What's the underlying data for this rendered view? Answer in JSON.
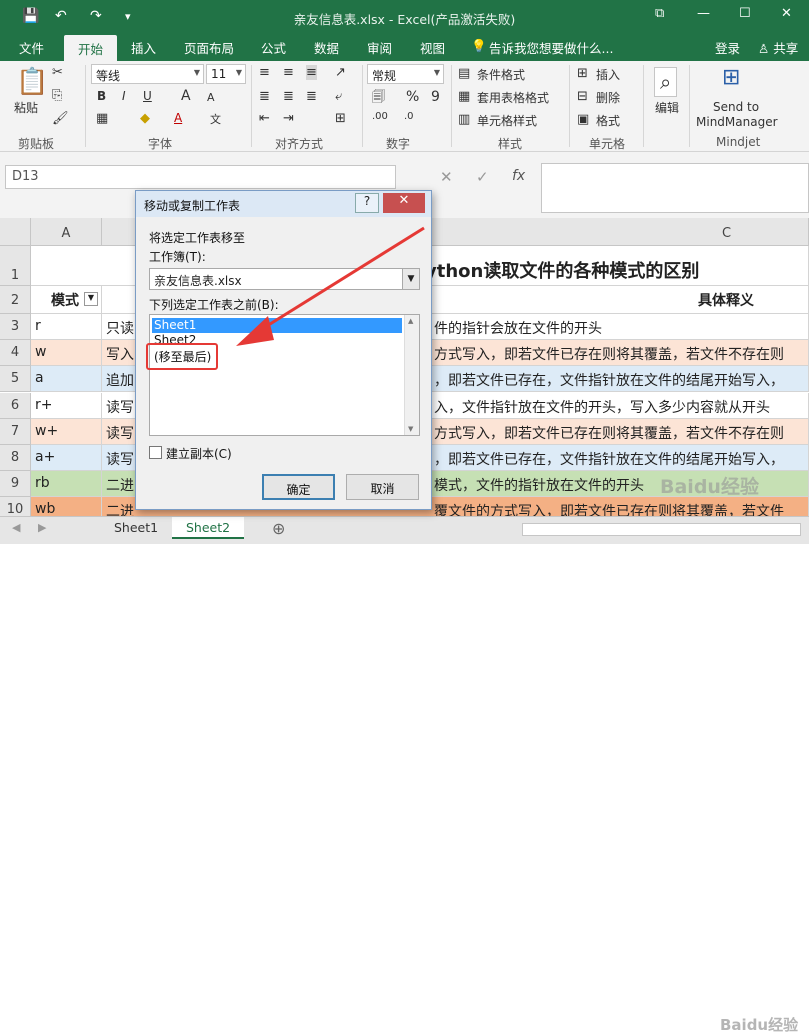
{
  "window": {
    "title": "亲友信息表.xlsx - Excel(产品激活失败)",
    "controls": {
      "restore": "⧉",
      "minimize": "—",
      "maximize": "☐",
      "close": "✕"
    }
  },
  "quick_access": {
    "save": "💾",
    "undo": "↶",
    "redo": "↷",
    "customize": "▾"
  },
  "ribbon_tabs": {
    "file": "文件",
    "home": "开始",
    "insert": "插入",
    "layout": "页面布局",
    "formulas": "公式",
    "data": "数据",
    "review": "审阅",
    "view": "视图",
    "tell_me": "告诉我您想要做什么...",
    "login": "登录",
    "share": "共享"
  },
  "ribbon": {
    "clipboard": {
      "paste": "粘贴",
      "label": "剪贴板"
    },
    "font": {
      "name": "等线",
      "size": "11",
      "bold": "B",
      "italic": "I",
      "underline": "U",
      "size_up": "A",
      "size_down": "A",
      "font_color": "A",
      "label": "字体"
    },
    "align": {
      "label": "对齐方式"
    },
    "number": {
      "format": "常规",
      "percent": "%",
      "comma": "9",
      "label": "数字"
    },
    "styles": {
      "conditional": "条件格式",
      "table": "套用表格格式",
      "cell_style": "单元格样式",
      "label": "样式"
    },
    "cells": {
      "insert": "插入",
      "delete": "删除",
      "format": "格式",
      "label": "单元格"
    },
    "editing": {
      "label": "编辑"
    },
    "mindjet": {
      "send_line1": "Send to",
      "send_line2": "MindManager",
      "label": "Mindjet"
    }
  },
  "formula_bar": {
    "name_box": "D13",
    "fx": "fx"
  },
  "grid": {
    "col_headers": {
      "a": "A",
      "c": "C"
    },
    "row_headers": [
      "1",
      "2",
      "3",
      "4",
      "5",
      "6",
      "7",
      "8",
      "9",
      "10"
    ],
    "title_cell": "ython读取文件的各种模式的区别",
    "header_a": "模式",
    "header_c": "具体释义",
    "rows": [
      {
        "a": "r",
        "b": "只读",
        "c": "件的指针会放在文件的开头",
        "color": "#ffffff"
      },
      {
        "a": "w",
        "b": "写入",
        "c": "方式写入，即若文件已存在则将其覆盖，若文件不存在则",
        "color": "#fce4d6"
      },
      {
        "a": "a",
        "b": "追加",
        "c": "，即若文件已存在，文件指针放在文件的结尾开始写入，",
        "color": "#ddebf7"
      },
      {
        "a": "r+",
        "b": "读写",
        "c": "入，文件指针放在文件的开头，写入多少内容就从开头",
        "c_bold": "写入多少内容就从开头",
        "color": "#ffffff"
      },
      {
        "a": "w+",
        "b": "读写",
        "c": "方式写入，即若文件已存在则将其覆盖，若文件不存在则",
        "color": "#fce4d6"
      },
      {
        "a": "a+",
        "b": "读写",
        "c": "，即若文件已存在，文件指针放在文件的结尾开始写入，",
        "color": "#ddebf7"
      },
      {
        "a": "rb",
        "b": "二进",
        "c": "模式，文件的指针放在文件的开头",
        "color": "#c6e0b4"
      },
      {
        "a": "wb",
        "b": "二进",
        "c": "覆文件的方式写入，即若文件已存在则将其覆盖，若文件",
        "color": "#f4b084"
      }
    ]
  },
  "sheet_tabs": [
    "Sheet1",
    "Sheet2"
  ],
  "add_sheet": "⊕",
  "dialog": {
    "title": "移动或复制工作表",
    "help": "?",
    "close": "✕",
    "move_label": "将选定工作表移至",
    "workbook_label": "工作簿(T):",
    "workbook_value": "亲友信息表.xlsx",
    "before_label": "下列选定工作表之前(B):",
    "sheets": [
      "Sheet1",
      "Sheet2",
      "(移至最后)"
    ],
    "selected_index": 0,
    "copy_checkbox": "建立副本(C)",
    "copy_checked": false,
    "ok": "确定",
    "cancel": "取消"
  },
  "watermark": "Baidu经验",
  "colors": {
    "excel_green": "#217346",
    "annotation_red": "#e53935"
  }
}
